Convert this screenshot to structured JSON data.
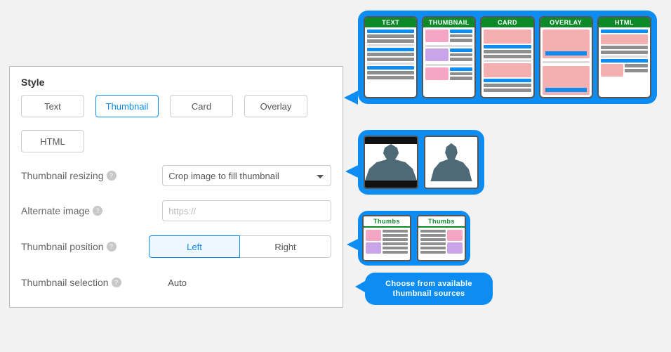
{
  "section": {
    "title": "Style"
  },
  "styleOptions": {
    "text": "Text",
    "thumbnail": "Thumbnail",
    "card": "Card",
    "overlay": "Overlay",
    "html": "HTML"
  },
  "labels": {
    "resizing": "Thumbnail resizing",
    "altImage": "Alternate image",
    "position": "Thumbnail position",
    "selection": "Thumbnail selection"
  },
  "resizing": {
    "value": "Crop image to fill thumbnail"
  },
  "altImage": {
    "placeholder": "https://"
  },
  "position": {
    "left": "Left",
    "right": "Right"
  },
  "selection": {
    "value": "Auto"
  },
  "callouts": {
    "styleHeaders": {
      "text": "TEXT",
      "thumb": "THUMBNAIL",
      "card": "CARD",
      "overlay": "OVERLAY",
      "html": "HTML"
    },
    "thumbsHead": "Thumbs",
    "selectText": "Choose from available thumbnail sources"
  }
}
